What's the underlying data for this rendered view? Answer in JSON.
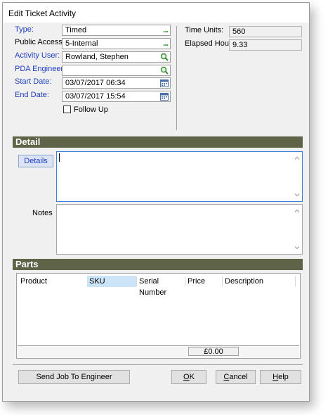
{
  "window": {
    "title": "Edit Ticket Activity"
  },
  "form": {
    "type": {
      "label": "Type:",
      "value": "Timed",
      "button": "..."
    },
    "public_access": {
      "label": "Public Access:",
      "value": "5-Internal",
      "button": "..."
    },
    "activity_user": {
      "label": "Activity User:",
      "value": "Rowland, Stephen"
    },
    "pda_engineer": {
      "label": "PDA Engineer:",
      "value": ""
    },
    "start_date": {
      "label": "Start Date:",
      "value": "03/07/2017 06:34"
    },
    "end_date": {
      "label": "End Date:",
      "value": "03/07/2017 15:54"
    },
    "follow_up": {
      "label": "Follow Up",
      "checked": false
    }
  },
  "stats": {
    "time_units": {
      "label": "Time Units:",
      "value": "560"
    },
    "elapsed_hours": {
      "label": "Elapsed Hours:",
      "value": "9.33"
    }
  },
  "detail": {
    "header": "Detail",
    "details_button": "Details",
    "details_value": "",
    "notes_label": "Notes",
    "notes_value": ""
  },
  "parts": {
    "header": "Parts",
    "columns": [
      "Product",
      "SKU",
      "Serial Number",
      "Price",
      "Description"
    ],
    "rows": [],
    "total": "£0.00"
  },
  "buttons": {
    "send": "Send Job To Engineer",
    "ok_u": "O",
    "ok_rest": "K",
    "cancel_u": "C",
    "cancel_rest": "ancel",
    "help_u": "H",
    "help_rest": "elp"
  },
  "colors": {
    "section_header": "#5f6448",
    "label_blue": "#1f3fbf",
    "ellipsis_green": "#2e9b2e"
  }
}
